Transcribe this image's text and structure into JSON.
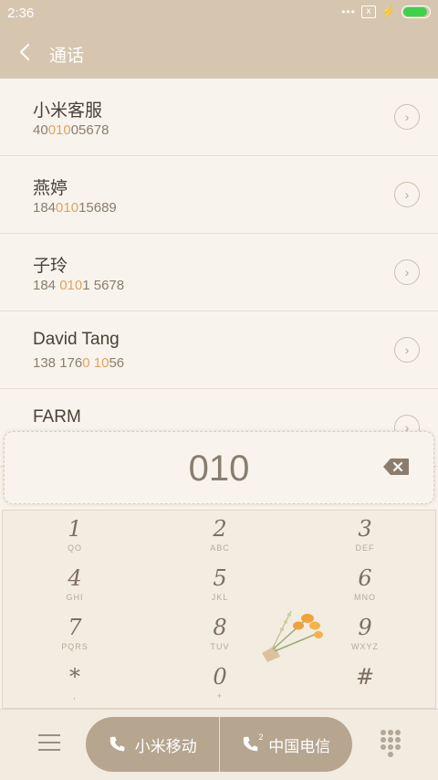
{
  "status": {
    "time": "2:36",
    "signal": "•••",
    "sim_state": "x",
    "battery_level": 0.85
  },
  "header": {
    "title": "通话"
  },
  "contacts": [
    {
      "name": "小米客服",
      "number_parts": [
        "40",
        "010",
        "05678"
      ]
    },
    {
      "name": "燕婷",
      "number_parts": [
        "184",
        "010",
        "15689"
      ]
    },
    {
      "name": "子玲",
      "number_parts": [
        "184 ",
        "010",
        "1 5678"
      ]
    },
    {
      "name": "David Tang",
      "number_parts": [
        "138 176",
        "0",
        " ",
        "10",
        "56"
      ]
    },
    {
      "name": "FARM",
      "number_parts": []
    }
  ],
  "dial_entry": {
    "digits": "010"
  },
  "keypad": [
    {
      "digit": "1",
      "letters": "QO"
    },
    {
      "digit": "2",
      "letters": "ABC"
    },
    {
      "digit": "3",
      "letters": "DEF"
    },
    {
      "digit": "4",
      "letters": "GHI"
    },
    {
      "digit": "5",
      "letters": "JKL"
    },
    {
      "digit": "6",
      "letters": "MNO"
    },
    {
      "digit": "7",
      "letters": "PQRS"
    },
    {
      "digit": "8",
      "letters": "TUV"
    },
    {
      "digit": "9",
      "letters": "WXYZ"
    },
    {
      "digit": "*",
      "letters": ","
    },
    {
      "digit": "0",
      "letters": "+"
    },
    {
      "digit": "#",
      "letters": ""
    }
  ],
  "bottom": {
    "sim1": {
      "label": "小米移动",
      "slot": ""
    },
    "sim2": {
      "label": "中国电信",
      "slot": "2"
    }
  },
  "colors": {
    "header_bg": "#d6c6b0",
    "highlight": "#e3a25d",
    "call_button": "#b6a58f",
    "battery": "#3bd34a"
  }
}
